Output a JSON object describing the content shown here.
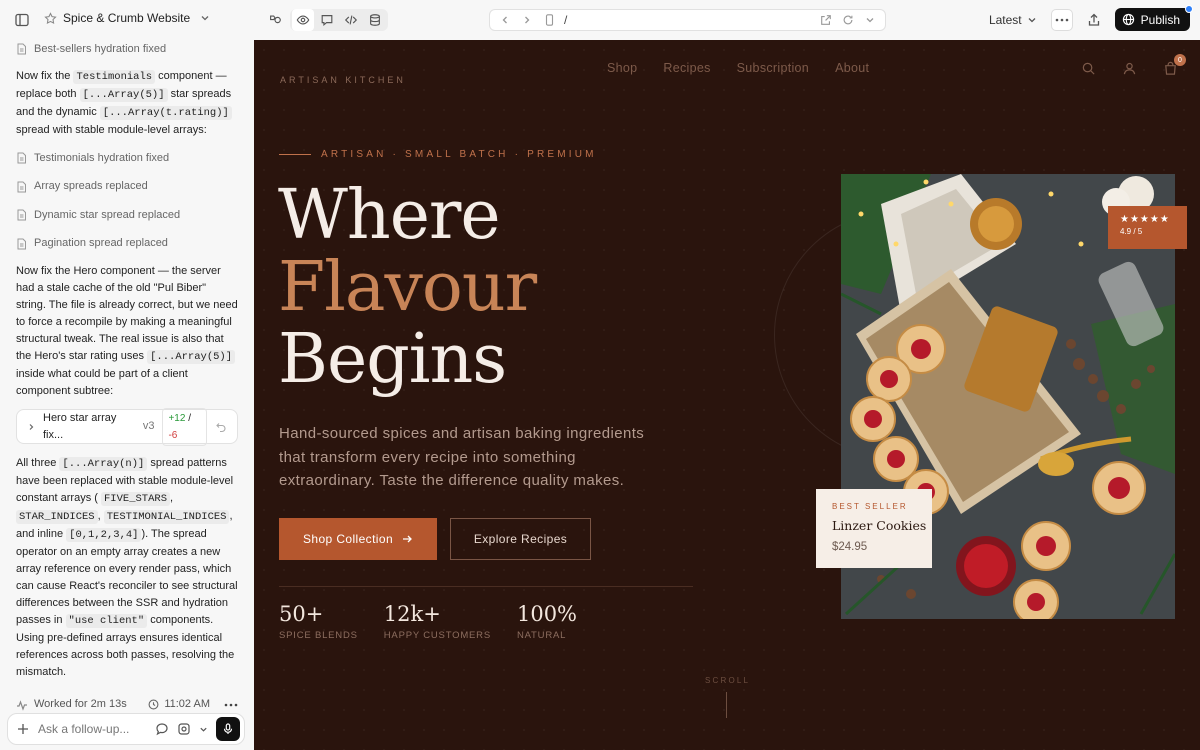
{
  "topbar": {
    "project_name": "Spice & Crumb Website",
    "url_path": "/",
    "version_label": "Latest",
    "publish_label": "Publish"
  },
  "chat": {
    "file_rows": {
      "best_sellers": "Best-sellers hydration fixed",
      "testimonials": "Testimonials hydration fixed",
      "array_spreads": "Array spreads replaced",
      "dynamic_star": "Dynamic star spread replaced",
      "pagination": "Pagination spread replaced"
    },
    "msg1": {
      "t1": "Now fix the ",
      "c1": "Testimonials",
      "t2": " component — replace both ",
      "c2": "[...Array(5)]",
      "t3": " star spreads and the dynamic ",
      "c3": "[...Array(t.rating)]",
      "t4": " spread with stable module-level arrays:"
    },
    "msg2": {
      "t1": "Now fix the Hero component — the server had a stale cache of the old \"Pul Biber\" string. The file is already correct, but we need to force a recompile by making a meaningful structural tweak. The real issue is also that the Hero's star rating uses ",
      "c1": "[...Array(5)]",
      "t2": " inside what could be part of a client component subtree:"
    },
    "version_card": {
      "name": "Hero star array fix...",
      "version": "v3",
      "additions": "+12",
      "deletions": "-6"
    },
    "msg3": {
      "t1": "All three ",
      "c1": "[...Array(n)]",
      "t2": " spread patterns have been replaced with stable module-level constant arrays ( ",
      "c2": "FIVE_STARS",
      "t3": ", ",
      "c3": "STAR_INDICES",
      "t4": ", ",
      "c4": "TESTIMONIAL_INDICES",
      "t5": ", and inline ",
      "c5": "[0,1,2,3,4]",
      "t6": "). The spread operator on an empty array creates a new array reference on every render pass, which can cause React's reconciler to see structural differences between the SSR and hydration passes in ",
      "c6": "\"use client\"",
      "t7": " components. Using pre-defined arrays ensures identical references across both passes, resolving the mismatch."
    },
    "worked_label": "Worked for 2m 13s",
    "time_label": "11:02 AM",
    "composer_placeholder": "Ask a follow-up..."
  },
  "site": {
    "logo": "ARTISAN KITCHEN",
    "nav": [
      "Shop",
      "Recipes",
      "Subscription",
      "About"
    ],
    "cart_count": "0",
    "eyebrow": "ARTISAN · SMALL BATCH · PREMIUM",
    "headline": {
      "line1": "Where",
      "line2": "Flavour",
      "line3": "Begins"
    },
    "description": "Hand-sourced spices and artisan baking ingredients that transform every recipe into something extraordinary. Taste the difference quality makes.",
    "primary_cta": "Shop Collection",
    "secondary_cta": "Explore Recipes",
    "stats": [
      {
        "value": "50+",
        "label": "SPICE BLENDS"
      },
      {
        "value": "12k+",
        "label": "HAPPY CUSTOMERS"
      },
      {
        "value": "100%",
        "label": "NATURAL"
      }
    ],
    "rating": {
      "stars": "★★★★★",
      "value": "4.9 / 5"
    },
    "best_seller": {
      "tag": "BEST SELLER",
      "name": "Linzer Cookies",
      "price": "$24.95"
    },
    "scroll_label": "SCROLL"
  },
  "colors": {
    "site_background": "#2a140d",
    "accent": "#b5572e",
    "headline_accent": "#c88457",
    "publish_button": "#111111"
  }
}
